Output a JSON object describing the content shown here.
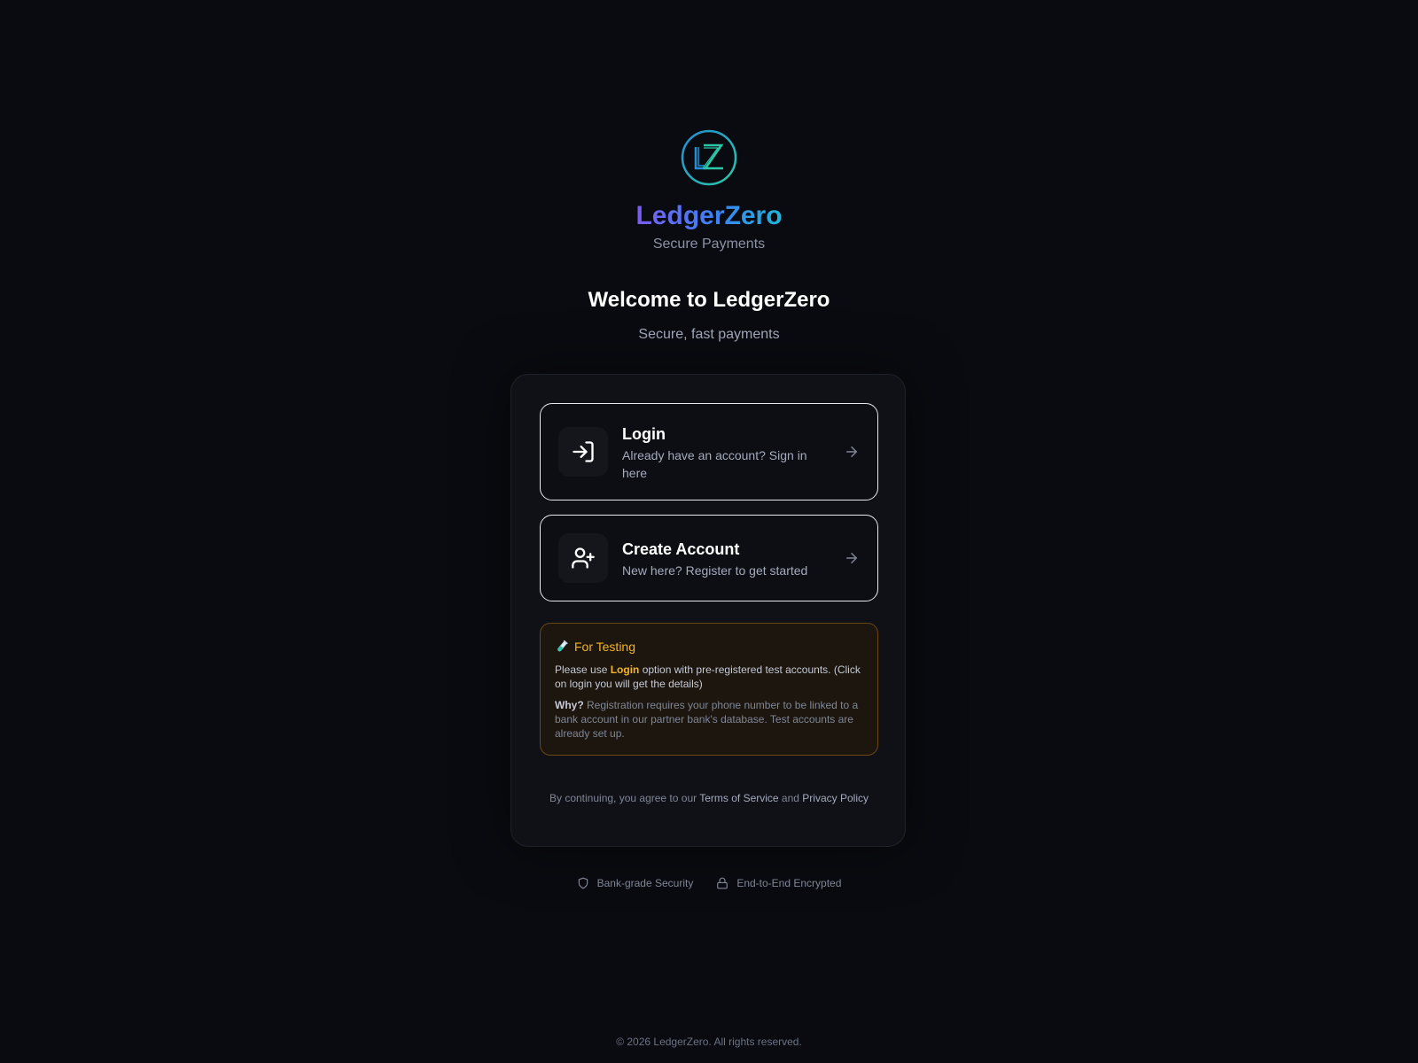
{
  "brand": {
    "name": "LedgerZero",
    "tagline": "Secure Payments",
    "logo_icon": "lz-monogram-logo"
  },
  "welcome": {
    "title": "Welcome to LedgerZero",
    "subtitle": "Secure, fast payments"
  },
  "options": {
    "login": {
      "title": "Login",
      "description": "Already have an account? Sign in here",
      "icon": "sign-in-icon"
    },
    "create": {
      "title": "Create Account",
      "description": "New here? Register to get started",
      "icon": "user-plus-icon"
    }
  },
  "testing": {
    "heading": "For Testing",
    "icon": "test-tube-icon",
    "p1_before": "Please use ",
    "p1_highlight": "Login",
    "p1_after": " option with pre-registered test accounts. (Click on login you will get the details)",
    "why_label": "Why?",
    "why_text": " Registration requires your phone number to be linked to a bank account in our partner bank's database. Test accounts are already set up."
  },
  "terms": {
    "prefix": "By continuing, you agree to our ",
    "terms_link": "Terms of Service",
    "middle": " and ",
    "privacy_link": "Privacy Policy"
  },
  "badges": {
    "security": "Bank-grade Security",
    "encrypted": "End-to-End Encrypted"
  },
  "footer": {
    "copyright": "© 2026 LedgerZero. All rights reserved."
  },
  "colors": {
    "background": "#0a0b10",
    "card": "#101116",
    "accent_amber": "#f5b424",
    "brand_gradient_start": "#7b5cf0",
    "brand_gradient_end": "#1fb6d6"
  }
}
